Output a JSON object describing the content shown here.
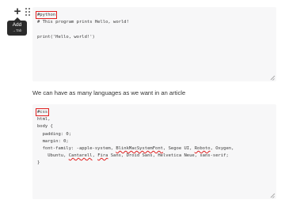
{
  "toolbar": {
    "add_icon": "plus-icon",
    "drag_icon": "drag-handle-icon",
    "tooltip": {
      "title": "Add",
      "shortcut": "→Tab"
    }
  },
  "blocks": [
    {
      "lang_tag": "#python",
      "lines": [
        "# This program prints Hello, world!",
        "",
        "print('Hello, world!')"
      ]
    },
    {
      "lang_tag": "#css",
      "lines": [
        "html,",
        "body {",
        "  padding: 0;",
        "  margin: 0;",
        "  font-family: -apple-system, BlinkMacSystemFont, Segoe UI, Roboto, Oxygen,",
        "    Ubuntu, Cantarell, Fira Sans, Droid Sans, Helvetica Neue, sans-serif;",
        "}"
      ]
    }
  ],
  "paragraph": "We can have as many languages as we want in an article",
  "colors": {
    "highlight": "#e02020",
    "code_bg": "#f7f7f8",
    "tooltip_bg": "#2b2b2b"
  }
}
